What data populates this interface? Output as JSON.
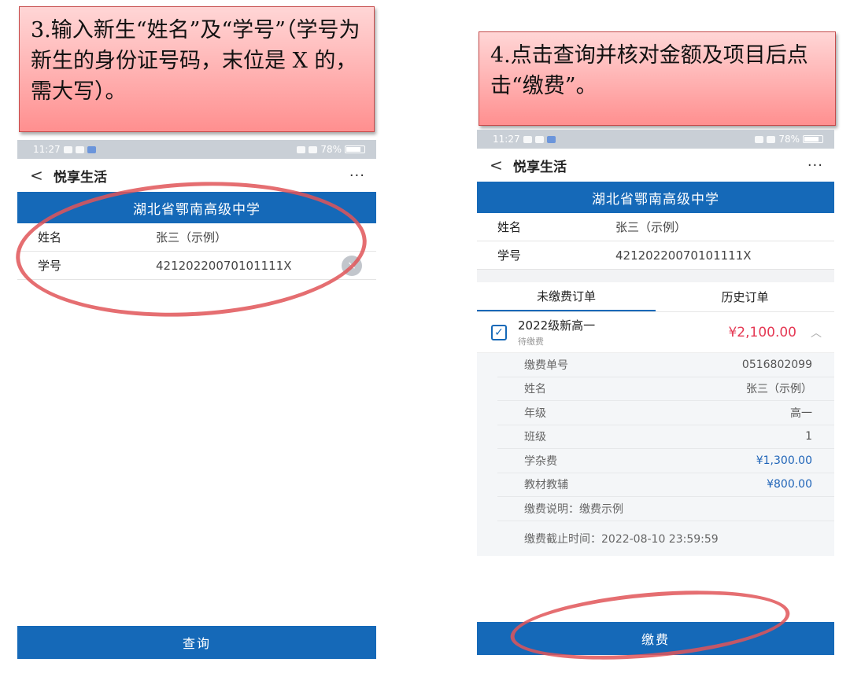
{
  "callouts": {
    "step3": "3.输入新生“姓名”及“学号”（学号为新生的身份证号码，末位是 X 的，需大写）。",
    "step4": "4.点击查询并核对金额及项目后点击“缴费”。"
  },
  "left_screen": {
    "status": {
      "time": "11:27",
      "battery": "78%"
    },
    "nav": {
      "back": "<",
      "title": "悦享生活",
      "more": "···"
    },
    "school": "湖北省鄂南高级中学",
    "fields": [
      {
        "label": "姓名",
        "value": "张三（示例）"
      },
      {
        "label": "学号",
        "value": "42120220070101111X"
      }
    ],
    "clear_icon": "×",
    "query_button": "查询"
  },
  "right_screen": {
    "status": {
      "time": "11:27",
      "battery": "78%"
    },
    "nav": {
      "back": "<",
      "title": "悦享生活",
      "more": "···"
    },
    "school": "湖北省鄂南高级中学",
    "fields": [
      {
        "label": "姓名",
        "value": "张三（示例）"
      },
      {
        "label": "学号",
        "value": "42120220070101111X"
      }
    ],
    "tabs": [
      {
        "label": "未缴费订单",
        "active": true
      },
      {
        "label": "历史订单",
        "active": false
      }
    ],
    "order": {
      "title": "2022级新高一",
      "status": "待缴费",
      "amount": "¥2,100.00",
      "details": [
        {
          "label": "缴费单号",
          "value": "0516802099"
        },
        {
          "label": "姓名",
          "value": "张三（示例）"
        },
        {
          "label": "年级",
          "value": "高一"
        },
        {
          "label": "班级",
          "value": "1"
        },
        {
          "label": "学杂费",
          "value": "¥1,300.00"
        },
        {
          "label": "教材教辅",
          "value": "¥800.00"
        }
      ],
      "note": "缴费说明：缴费示例",
      "deadline": "缴费截止时间：2022-08-10 23:59:59"
    },
    "pay_button": "缴费"
  },
  "colors": {
    "brand_blue": "#1569b8",
    "amount_red": "#e53954",
    "annotation_red": "#e05558"
  }
}
